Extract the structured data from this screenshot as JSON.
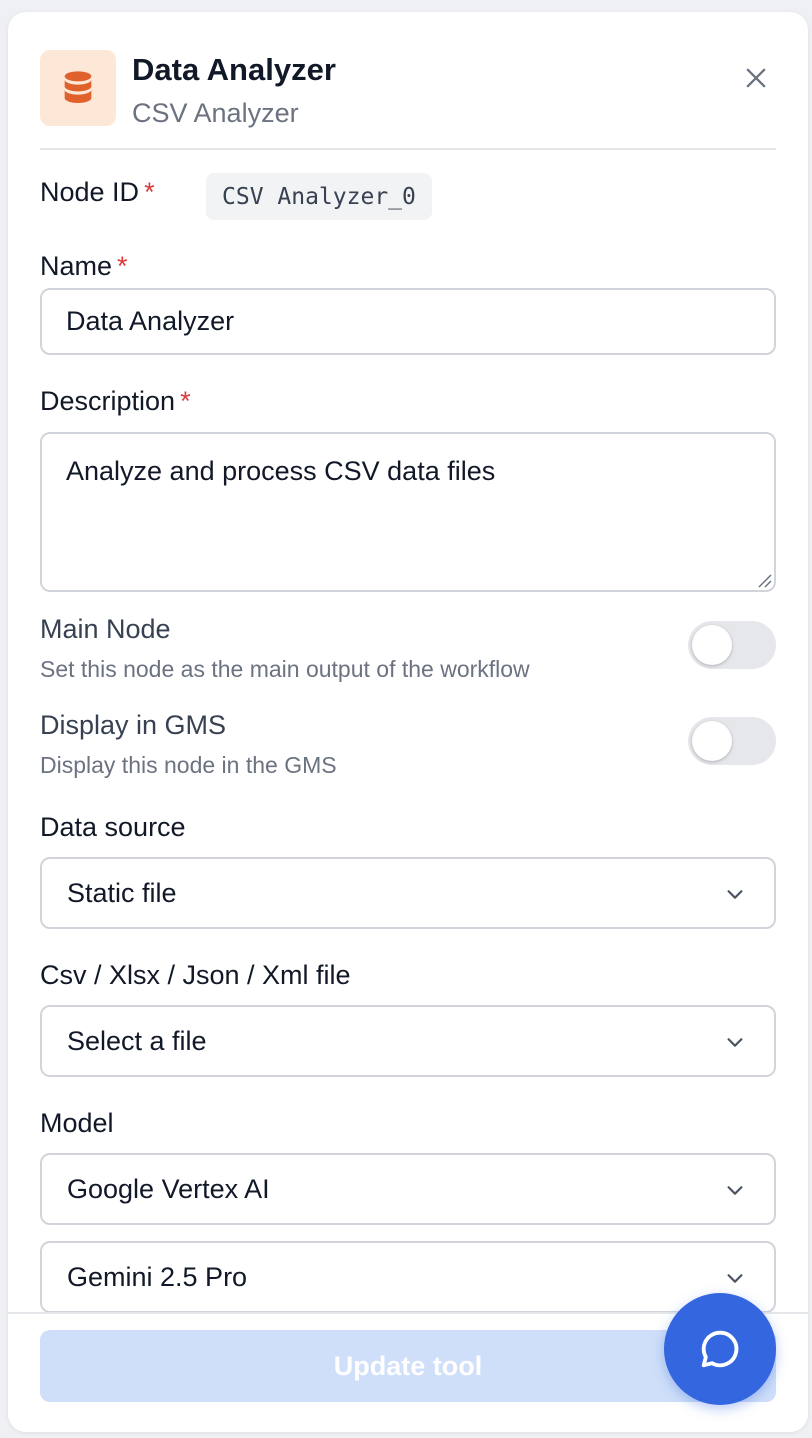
{
  "header": {
    "title": "Data Analyzer",
    "subtitle": "CSV Analyzer",
    "icon": "database-icon",
    "icon_color": "#e0612b"
  },
  "fields": {
    "node_id": {
      "label": "Node ID",
      "required_mark": "*",
      "value": "CSV Analyzer_0"
    },
    "name": {
      "label": "Name",
      "required_mark": "*",
      "value": "Data Analyzer"
    },
    "description": {
      "label": "Description",
      "required_mark": "*",
      "value": "Analyze and process CSV data files"
    }
  },
  "toggles": {
    "main_node": {
      "title": "Main Node",
      "description": "Set this node as the main output of the workflow",
      "enabled": false
    },
    "display_gms": {
      "title": "Display in GMS",
      "description": "Display this node in the GMS",
      "enabled": false
    }
  },
  "data_source": {
    "label": "Data source",
    "selected": "Static file"
  },
  "file": {
    "label": "Csv / Xlsx / Json / Xml file",
    "selected": "Select a file"
  },
  "model": {
    "label": "Model",
    "provider": "Google Vertex AI",
    "model_name": "Gemini 2.5 Pro"
  },
  "footer": {
    "update_label": "Update tool",
    "button_color": "#cfdff9",
    "chat_icon": "chat-bubble-icon",
    "chat_color": "#3466e0"
  }
}
